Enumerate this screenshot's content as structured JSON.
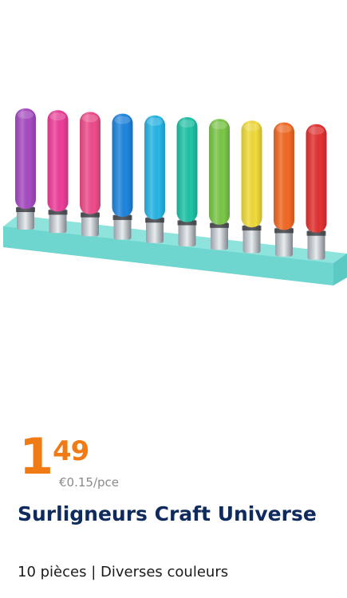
{
  "product": {
    "image_alt": "Highlighter set in a turquoise holder",
    "price_integer": "1",
    "price_decimal": "49",
    "unit_price": "€0.15/pce",
    "title": "Surligneurs Craft Universe",
    "subtitle": "10 pièces | Diverses couleurs"
  },
  "colors": {
    "price": "#f07a14",
    "title": "#0f2a5c",
    "holder": "#7fded8",
    "markers": [
      "#a84cc4",
      "#ee3f9a",
      "#f04d8c",
      "#1f86e0",
      "#27b7e8",
      "#1fc4a8",
      "#7cc84a",
      "#f2dc3a",
      "#f46a24",
      "#e53232"
    ]
  }
}
